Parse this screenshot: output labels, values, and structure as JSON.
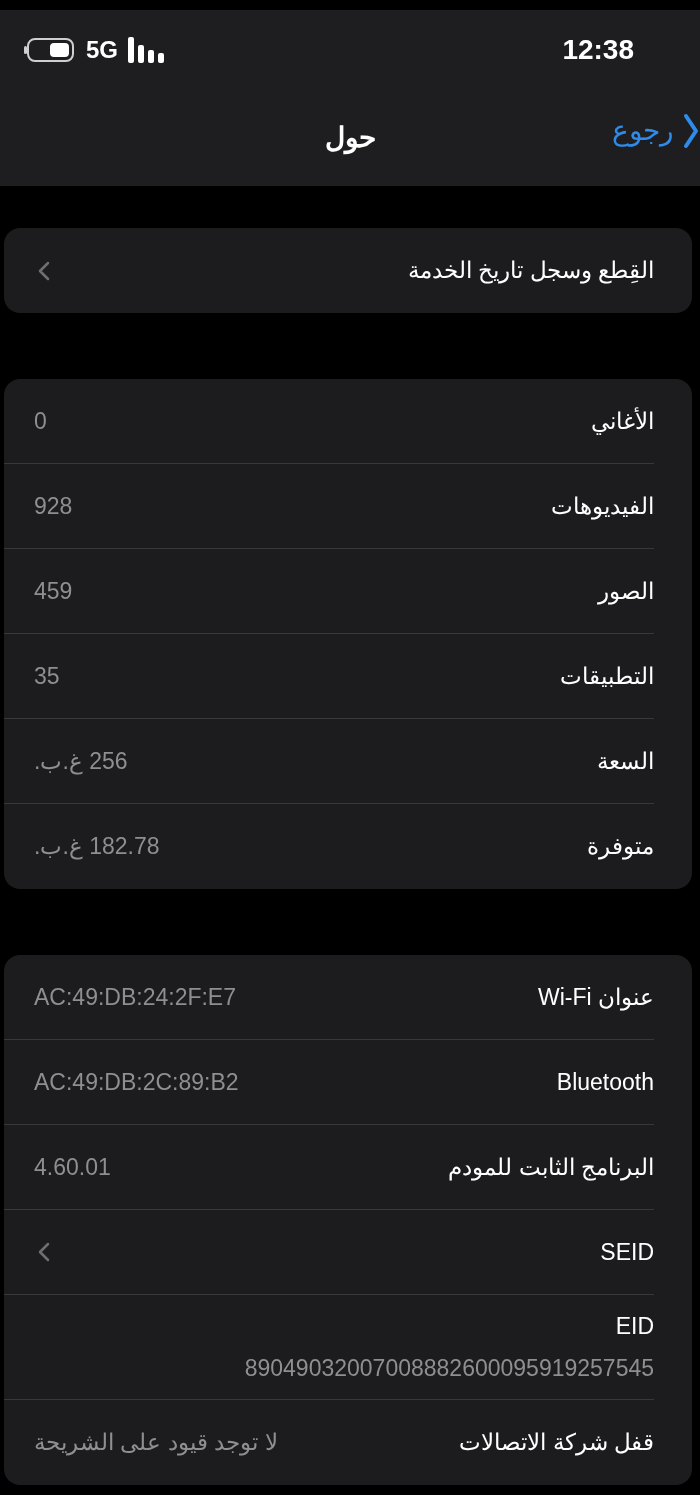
{
  "status_bar": {
    "network": "5G",
    "time": "12:38"
  },
  "nav": {
    "back": "رجوع",
    "title": "حول"
  },
  "groups": [
    {
      "rows": [
        {
          "kind": "link",
          "label": "القِطع وسجل تاريخ الخدمة"
        }
      ]
    },
    {
      "rows": [
        {
          "kind": "value",
          "label": "الأغاني",
          "value": "0"
        },
        {
          "kind": "value",
          "label": "الفيديوهات",
          "value": "928"
        },
        {
          "kind": "value",
          "label": "الصور",
          "value": "459"
        },
        {
          "kind": "value",
          "label": "التطبيقات",
          "value": "35"
        },
        {
          "kind": "value",
          "label": "السعة",
          "value": "256 غ.ب."
        },
        {
          "kind": "value",
          "label": "متوفرة",
          "value": "182.78 غ.ب."
        }
      ]
    },
    {
      "rows": [
        {
          "kind": "value",
          "label": "عنوان Wi-Fi",
          "value": "AC:49:DB:24:2F:E7"
        },
        {
          "kind": "value",
          "label": "Bluetooth",
          "value": "AC:49:DB:2C:89:B2"
        },
        {
          "kind": "value",
          "label": "البرنامج الثابت للمودم",
          "value": "4.60.01"
        },
        {
          "kind": "link",
          "label": "SEID"
        },
        {
          "kind": "stacked",
          "label": "EID",
          "value": "89049032007008882600095919257545"
        },
        {
          "kind": "value",
          "label": "قفل شركة الاتصالات",
          "value": "لا توجد قيود على الشريحة"
        }
      ]
    }
  ]
}
